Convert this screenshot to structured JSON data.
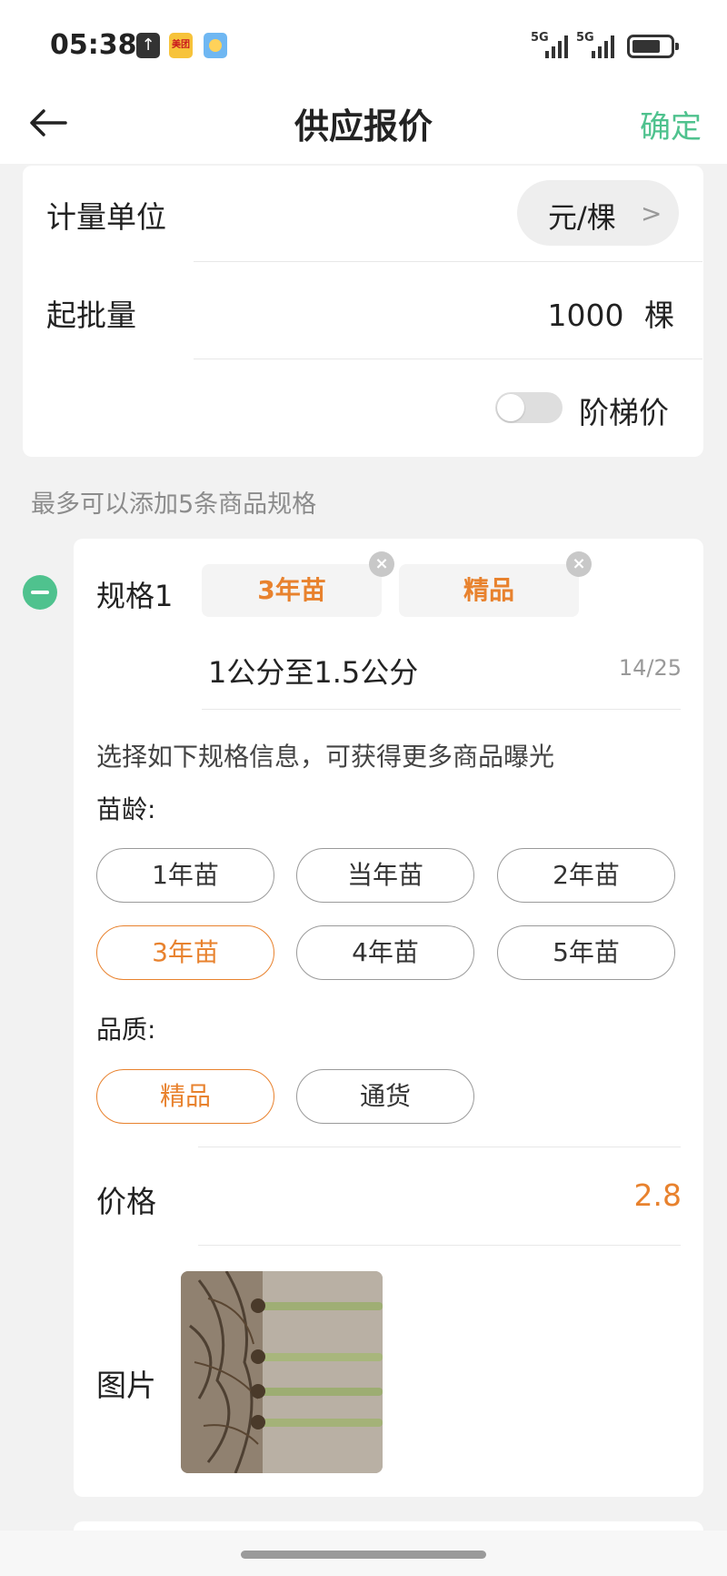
{
  "status_bar": {
    "time": "05:38",
    "icons": [
      "upload-icon",
      "meituan-app-icon",
      "weather-icon"
    ],
    "meituan_text": "美团",
    "signal_1_label": "5G",
    "signal_2_label": "5G",
    "battery_level": 0.7
  },
  "nav": {
    "title": "供应报价",
    "confirm_label": "确定",
    "back_icon": "back-arrow-icon",
    "confirm_color": "#4fc28e"
  },
  "basic": {
    "unit_label": "计量单位",
    "unit_value": "元/棵",
    "min_qty_label": "起批量",
    "min_qty_value": "1000",
    "min_qty_unit": "棵",
    "tier_price_label": "阶梯价",
    "tier_price_enabled": false
  },
  "spec_hint": "最多可以添加5条商品规格",
  "spec": {
    "label": "规格1",
    "tags": [
      {
        "text": "3年苗"
      },
      {
        "text": "精品"
      }
    ],
    "name_value": "1公分至1.5公分",
    "name_count": "14/25",
    "select_hint": "选择如下规格信息，可获得更多商品曝光",
    "age_label": "苗龄:",
    "age_options": [
      "1年苗",
      "当年苗",
      "2年苗",
      "3年苗",
      "4年苗",
      "5年苗"
    ],
    "age_selected": "3年苗",
    "quality_label": "品质:",
    "quality_options": [
      "精品",
      "通货"
    ],
    "quality_selected": "精品",
    "price_label": "价格",
    "price_value": "2.8",
    "photo_label": "图片"
  },
  "colors": {
    "accent_green": "#4fc28e",
    "accent_orange": "#e8822e"
  }
}
